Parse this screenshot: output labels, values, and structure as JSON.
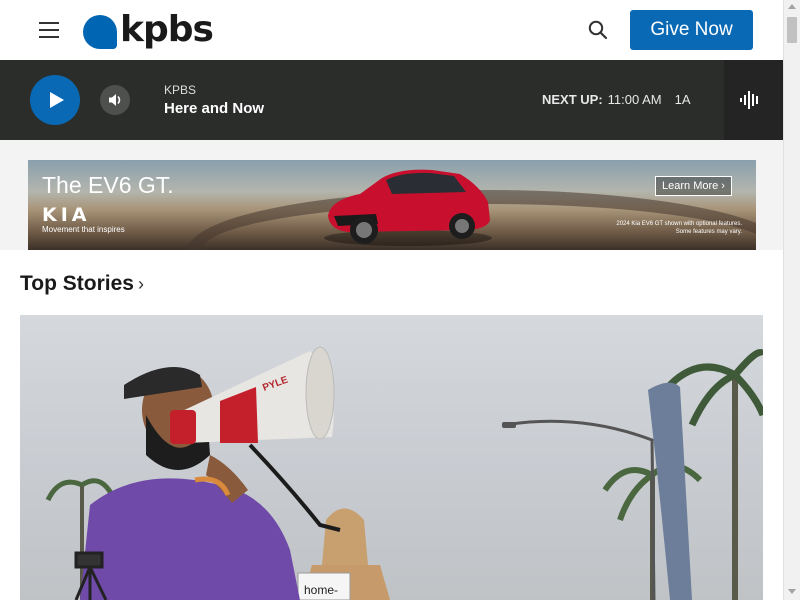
{
  "header": {
    "logo_text": "kpbs",
    "give_label": "Give Now"
  },
  "player": {
    "station": "KPBS",
    "program": "Here and Now",
    "next_label": "NEXT UP:",
    "next_time": "11:00 AM",
    "next_program": "1A"
  },
  "ad": {
    "headline": "The EV6 GT.",
    "brand": "KIA",
    "tagline": "Movement that inspires",
    "cta": "Learn More ›",
    "disclaimer_1": "2024 Kia EV6 GT shown with optional features.",
    "disclaimer_2": "Some features may vary."
  },
  "top_stories": {
    "title": "Top Stories",
    "chevron": "›"
  },
  "hero": {
    "megaphone_brand": "PYLE",
    "sign_text": "home-"
  },
  "colors": {
    "brand_blue": "#0a69b5",
    "player_bg": "#2b2d2b"
  }
}
